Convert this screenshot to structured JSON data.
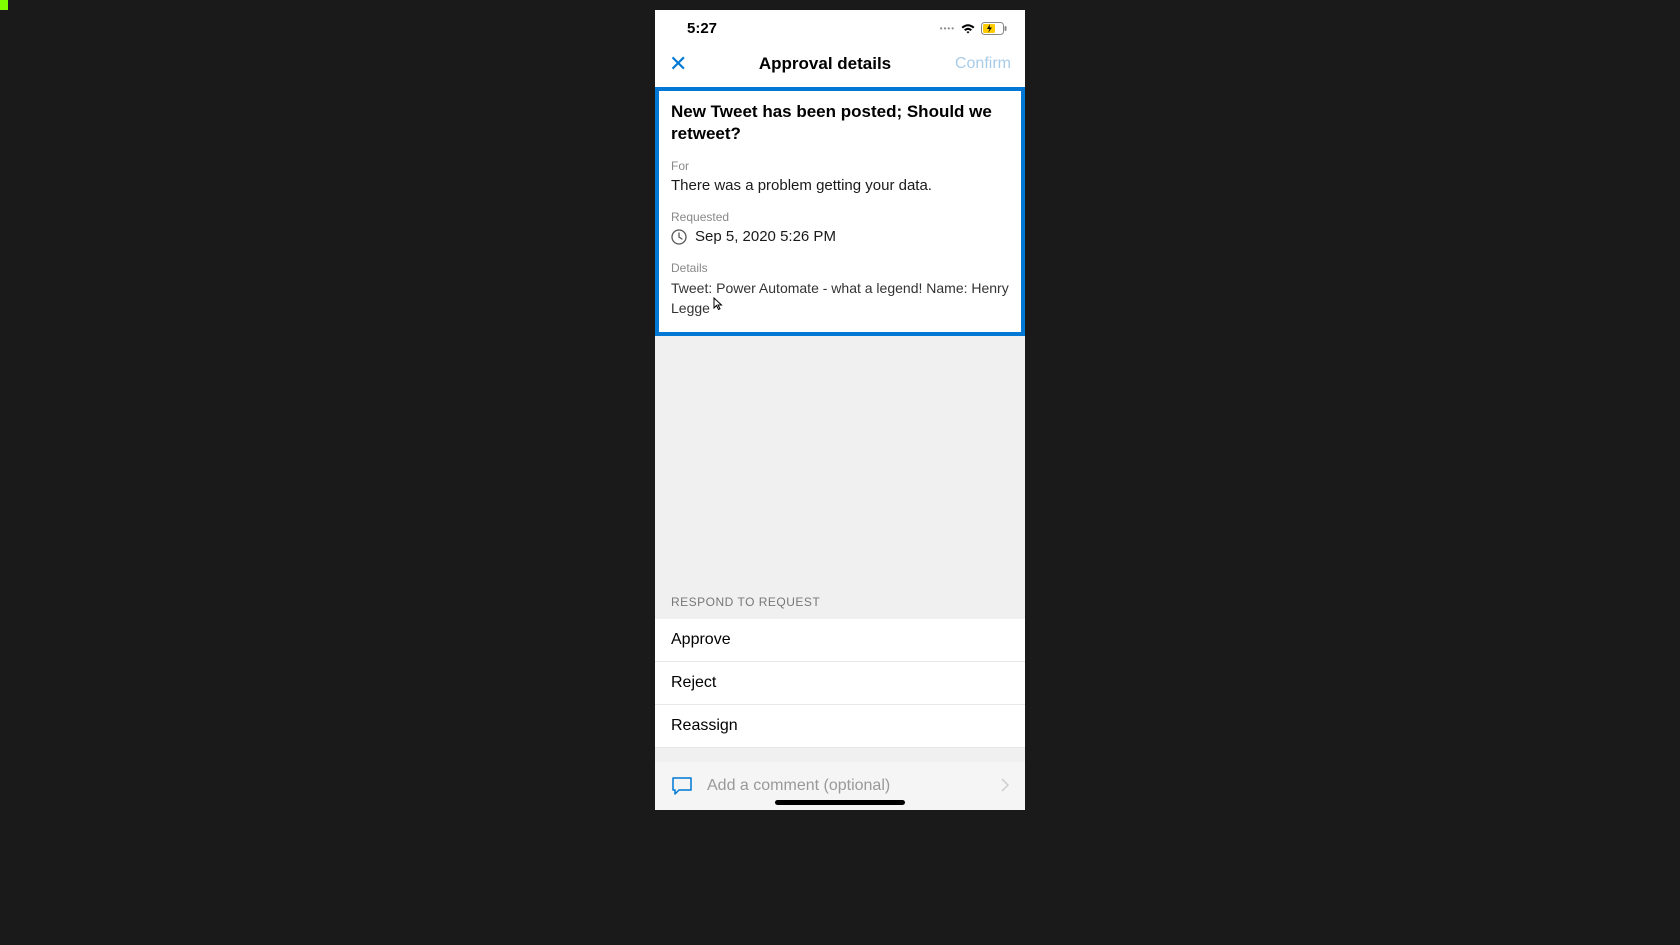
{
  "status_bar": {
    "time": "5:27"
  },
  "nav": {
    "title": "Approval details",
    "confirm_label": "Confirm"
  },
  "approval": {
    "title": "New Tweet has been posted; Should we retweet?",
    "for_label": "For",
    "for_value": "There was a problem getting your data.",
    "requested_label": "Requested",
    "requested_value": "Sep 5, 2020 5:26 PM",
    "details_label": "Details",
    "details_value": "Tweet: Power Automate - what a legend! Name: Henry Legge"
  },
  "respond": {
    "section_label": "RESPOND TO REQUEST",
    "approve": "Approve",
    "reject": "Reject",
    "reassign": "Reassign"
  },
  "comment": {
    "placeholder": "Add a comment (optional)"
  }
}
